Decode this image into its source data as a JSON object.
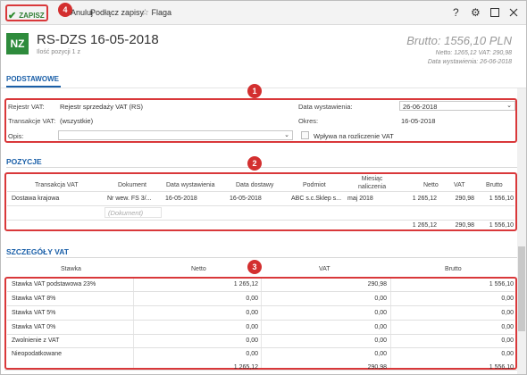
{
  "toolbar": {
    "save_label": "ZAPISZ",
    "cancel_label": "Anuluj",
    "attach_label": "Podłącz zapisy",
    "flag_label": "Flaga",
    "help_icon": "question-icon",
    "settings_icon": "gear-icon",
    "maximize_icon": "maximize-icon",
    "close_icon": "close-icon"
  },
  "badges": [
    "1",
    "2",
    "3",
    "4"
  ],
  "header": {
    "type_badge": "NZ",
    "title": "RS-DZS 16-05-2018",
    "subtitle": "Ilość pozycji 1 z",
    "brutto": "Brutto: 1556,10 PLN",
    "netto_vat": "Netto: 1265,12 VAT: 290,98",
    "issue_date": "Data wystawienia: 26-06-2018"
  },
  "tab": {
    "label": "PODSTAWOWE"
  },
  "basic": {
    "register_label": "Rejestr VAT:",
    "register_value": "Rejestr sprzedaży VAT (RS)",
    "transactions_label": "Transakcje VAT:",
    "transactions_value": "(wszystkie)",
    "description_label": "Opis:",
    "description_value": "",
    "issue_date_label": "Data wystawienia:",
    "issue_date_value": "26-06-2018",
    "period_label": "Okres:",
    "period_value": "16-05-2018",
    "settlement_label": "Wpływa na rozliczenie VAT"
  },
  "positions": {
    "title": "POZYCJE",
    "columns": [
      "Transakcja VAT",
      "Dokument",
      "Data wystawienia",
      "Data dostawy",
      "Podmiot",
      "Miesiąc naliczenia",
      "Netto",
      "VAT",
      "Brutto"
    ],
    "month_col_line1": "Miesiąc",
    "month_col_line2": "naliczenia",
    "rows": [
      {
        "transaction": "Dostawa krajowa",
        "document": "Nr wew. FS 3/...",
        "issue_date": "16-05-2018",
        "delivery_date": "16-05-2018",
        "entity": "ABC s.c.Sklep s...",
        "month": "maj 2018",
        "netto": "1 265,12",
        "vat": "290,98",
        "brutto": "1 556,10"
      }
    ],
    "new_row_placeholder": "(Dokument)",
    "totals": {
      "netto": "1 265,12",
      "vat": "290,98",
      "brutto": "1 556,10"
    }
  },
  "vat_details": {
    "title": "SZCZEGÓŁY VAT",
    "columns": [
      "Stawka",
      "Netto",
      "VAT",
      "Brutto"
    ],
    "rows": [
      {
        "rate": "Stawka VAT podstawowa 23%",
        "netto": "1 265,12",
        "vat": "290,98",
        "brutto": "1 556,10"
      },
      {
        "rate": "Stawka VAT 8%",
        "netto": "0,00",
        "vat": "0,00",
        "brutto": "0,00"
      },
      {
        "rate": "Stawka VAT 5%",
        "netto": "0,00",
        "vat": "0,00",
        "brutto": "0,00"
      },
      {
        "rate": "Stawka VAT 0%",
        "netto": "0,00",
        "vat": "0,00",
        "brutto": "0,00"
      },
      {
        "rate": "Zwolnienie z VAT",
        "netto": "0,00",
        "vat": "0,00",
        "brutto": "0,00"
      },
      {
        "rate": "Nieopodatkowane",
        "netto": "0,00",
        "vat": "0,00",
        "brutto": "0,00"
      }
    ],
    "totals": {
      "netto": "1 265,12",
      "vat": "290,98",
      "brutto": "1 556,10"
    }
  },
  "colors": {
    "accent": "#1a5fa8",
    "save_green": "#2e8b2e",
    "badge_red": "#d32f2f",
    "highlight_red": "#d9383a",
    "type_green": "#2e8b3c"
  }
}
